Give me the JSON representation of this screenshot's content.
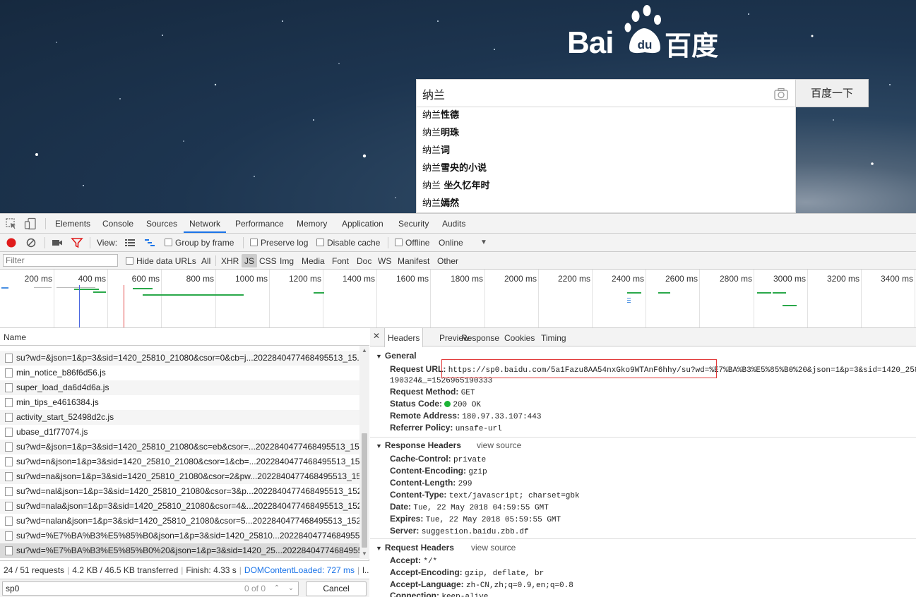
{
  "baidu": {
    "logo_latin": "Bai",
    "logo_du": "du",
    "logo_chinese": "百度",
    "search_value": "纳兰",
    "search_button": "百度一下",
    "suggestions": [
      {
        "prefix": "纳兰",
        "rest": "性德"
      },
      {
        "prefix": "纳兰",
        "rest": "明珠"
      },
      {
        "prefix": "纳兰",
        "rest": "词"
      },
      {
        "prefix": "纳兰",
        "rest": "雪央的小说"
      },
      {
        "prefix": "纳兰",
        "rest": " 坐久忆年时"
      },
      {
        "prefix": "纳兰",
        "rest": "嫣然"
      }
    ]
  },
  "devtools": {
    "tabs": [
      "Elements",
      "Console",
      "Sources",
      "Network",
      "Performance",
      "Memory",
      "Application",
      "Security",
      "Audits"
    ],
    "active_tab": "Network",
    "toolbar": {
      "view_label": "View:",
      "group_by_frame": "Group by frame",
      "preserve_log": "Preserve log",
      "disable_cache": "Disable cache",
      "offline": "Offline",
      "throttle": "Online"
    },
    "filter": {
      "placeholder": "Filter",
      "hide_data_urls": "Hide data URLs",
      "types": [
        "All",
        "XHR",
        "JS",
        "CSS",
        "Img",
        "Media",
        "Font",
        "Doc",
        "WS",
        "Manifest",
        "Other"
      ],
      "selected_type": "JS"
    },
    "timeline_ticks": [
      "200 ms",
      "400 ms",
      "600 ms",
      "800 ms",
      "1000 ms",
      "1200 ms",
      "1400 ms",
      "1600 ms",
      "1800 ms",
      "2000 ms",
      "2200 ms",
      "2400 ms",
      "2600 ms",
      "2800 ms",
      "3000 ms",
      "3200 ms",
      "3400 ms"
    ],
    "requests": {
      "column_name": "Name",
      "rows": [
        "su?wd=&json=1&p=3&sid=1420_25810_21080&csor=0&cb=j...2022840477468495513_15...",
        "min_notice_b86f6d56.js",
        "super_load_da6d4d6a.js",
        "min_tips_e4616384.js",
        "activity_start_52498d2c.js",
        "ubase_d1f77074.js",
        "su?wd=&json=1&p=3&sid=1420_25810_21080&sc=eb&csor=...2022840477468495513_15",
        "su?wd=n&json=1&p=3&sid=1420_25810_21080&csor=1&cb=...2022840477468495513_15",
        "su?wd=na&json=1&p=3&sid=1420_25810_21080&csor=2&pw...2022840477468495513_15",
        "su?wd=nal&json=1&p=3&sid=1420_25810_21080&csor=3&p...2022840477468495513_152",
        "su?wd=nala&json=1&p=3&sid=1420_25810_21080&csor=4&...2022840477468495513_152",
        "su?wd=nalan&json=1&p=3&sid=1420_25810_21080&csor=5...2022840477468495513_152",
        "su?wd=%E7%BA%B3%E5%85%B0&json=1&p=3&sid=1420_25810...2022840477468495513_15",
        "su?wd=%E7%BA%B3%E5%85%B0%20&json=1&p=3&sid=1420_25...2022840477468495513..."
      ]
    },
    "status": {
      "requests": "24 / 51 requests",
      "transferred": "4.2 KB / 46.5 KB transferred",
      "finish": "Finish: 4.33 s",
      "dcl": "DOMContentLoaded: 727 ms",
      "more": "l..."
    },
    "find": {
      "value": "sp0",
      "count": "0 of 0",
      "cancel": "Cancel"
    },
    "detail_tabs": [
      "Headers",
      "Preview",
      "Response",
      "Cookies",
      "Timing"
    ],
    "active_detail_tab": "Headers",
    "general": {
      "title": "General",
      "request_url_key": "Request URL:",
      "request_url": "https://sp0.baidu.com/5a1Fazu8AA54nxGko9WTAnF6hhy/su?wd=%E7%BA%B3%E5%85%B0%20&json=1&p=3&sid=1420_258",
      "request_url_cont": "190324&_=1526965190333",
      "method_key": "Request Method:",
      "method": "GET",
      "status_key": "Status Code:",
      "status": "200 OK",
      "remote_key": "Remote Address:",
      "remote": "180.97.33.107:443",
      "referrer_key": "Referrer Policy:",
      "referrer": "unsafe-url"
    },
    "response_headers": {
      "title": "Response Headers",
      "view_source": "view source",
      "items": [
        {
          "k": "Cache-Control:",
          "v": "private"
        },
        {
          "k": "Content-Encoding:",
          "v": "gzip"
        },
        {
          "k": "Content-Length:",
          "v": "299"
        },
        {
          "k": "Content-Type:",
          "v": "text/javascript; charset=gbk"
        },
        {
          "k": "Date:",
          "v": "Tue, 22 May 2018 04:59:55 GMT"
        },
        {
          "k": "Expires:",
          "v": "Tue, 22 May 2018 05:59:55 GMT"
        },
        {
          "k": "Server:",
          "v": "suggestion.baidu.zbb.df"
        }
      ]
    },
    "request_headers": {
      "title": "Request Headers",
      "view_source": "view source",
      "items": [
        {
          "k": "Accept:",
          "v": "*/*"
        },
        {
          "k": "Accept-Encoding:",
          "v": "gzip, deflate, br"
        },
        {
          "k": "Accept-Language:",
          "v": "zh-CN,zh;q=0.9,en;q=0.8"
        },
        {
          "k": "Connection:",
          "v": "keep-alive"
        }
      ]
    },
    "colors": {
      "accent": "#1a73e8",
      "record": "#e01b1b",
      "status_ok": "#1cb436",
      "highlight_box": "#e23b3b"
    }
  }
}
